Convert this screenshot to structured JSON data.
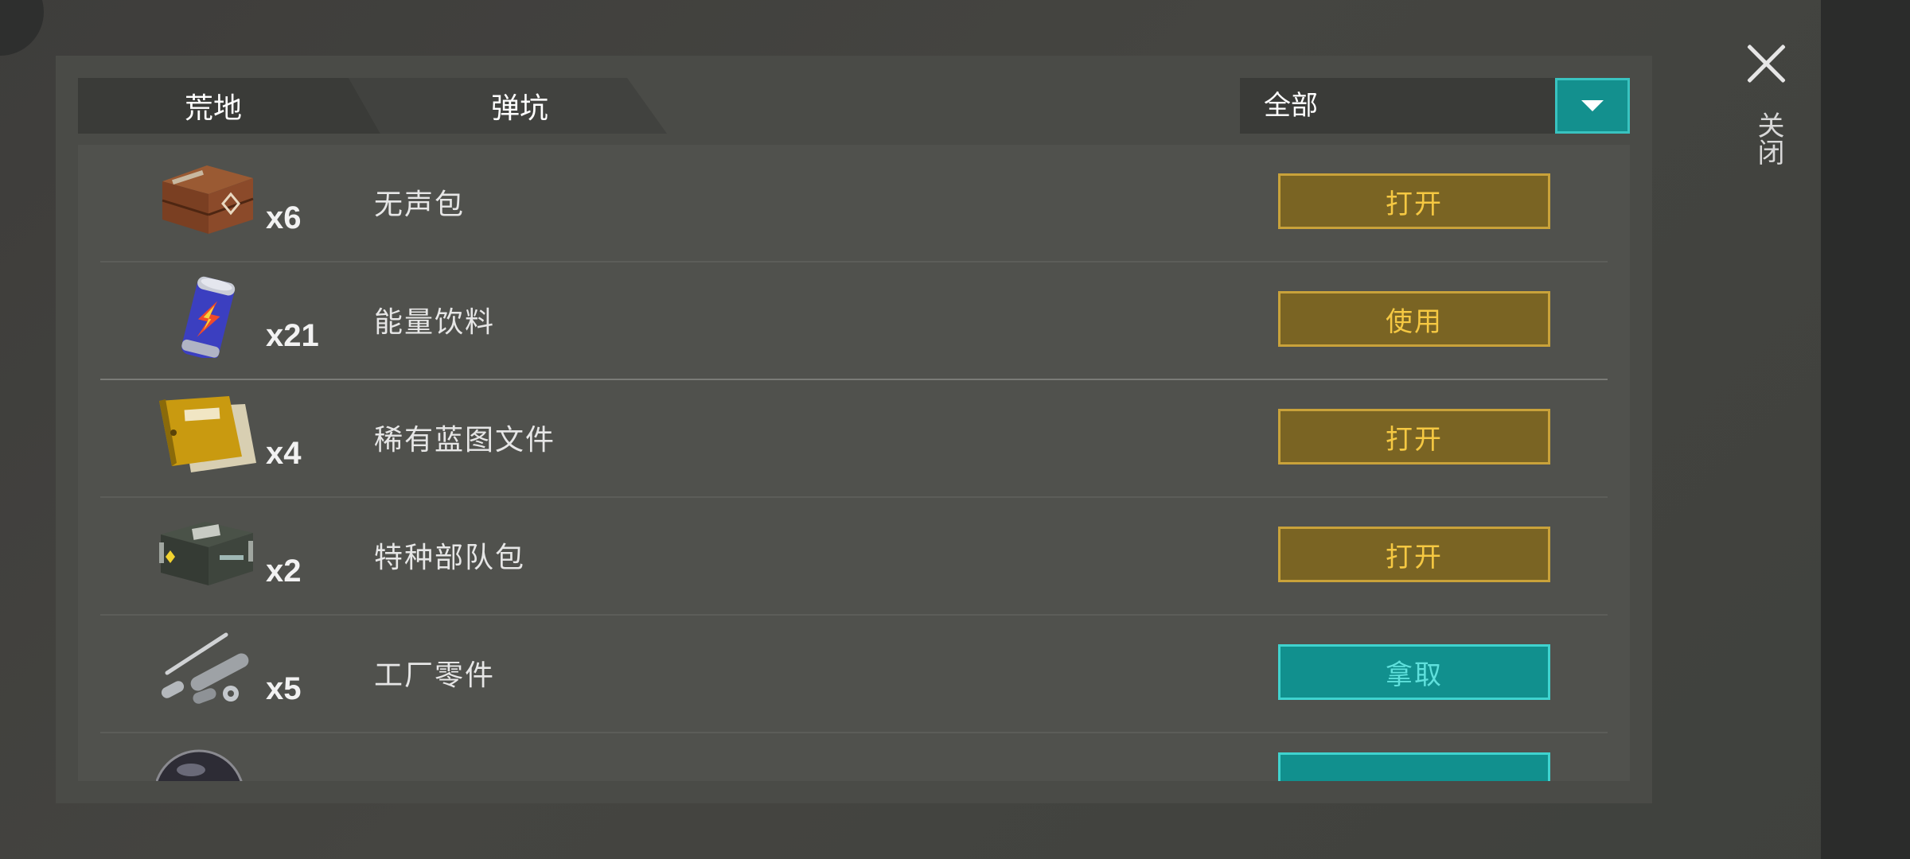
{
  "tabs": [
    {
      "label": "荒地",
      "active": true
    },
    {
      "label": "弹坑",
      "active": false
    }
  ],
  "filter": {
    "label": "全部",
    "icon": "dropdown-arrow-icon"
  },
  "close": {
    "label": "关闭",
    "icon": "close-icon"
  },
  "items": [
    {
      "name": "无声包",
      "qty": "x6",
      "action": "打开",
      "action_style": "gold",
      "icon": "wooden-crate-icon"
    },
    {
      "name": "能量饮料",
      "qty": "x21",
      "action": "使用",
      "action_style": "gold",
      "icon": "energy-drink-can-icon"
    },
    {
      "name": "稀有蓝图文件",
      "qty": "x4",
      "action": "打开",
      "action_style": "gold",
      "icon": "blueprint-folder-icon"
    },
    {
      "name": "特种部队包",
      "qty": "x2",
      "action": "打开",
      "action_style": "gold",
      "icon": "military-case-icon"
    },
    {
      "name": "工厂零件",
      "qty": "x5",
      "action": "拿取",
      "action_style": "teal",
      "icon": "factory-parts-icon"
    }
  ],
  "colors": {
    "gold_button": "#7a6423",
    "gold_text": "#f5c842",
    "teal_button": "#11908e",
    "teal_text": "#5fe0dc",
    "panel": "#4a4b47"
  }
}
